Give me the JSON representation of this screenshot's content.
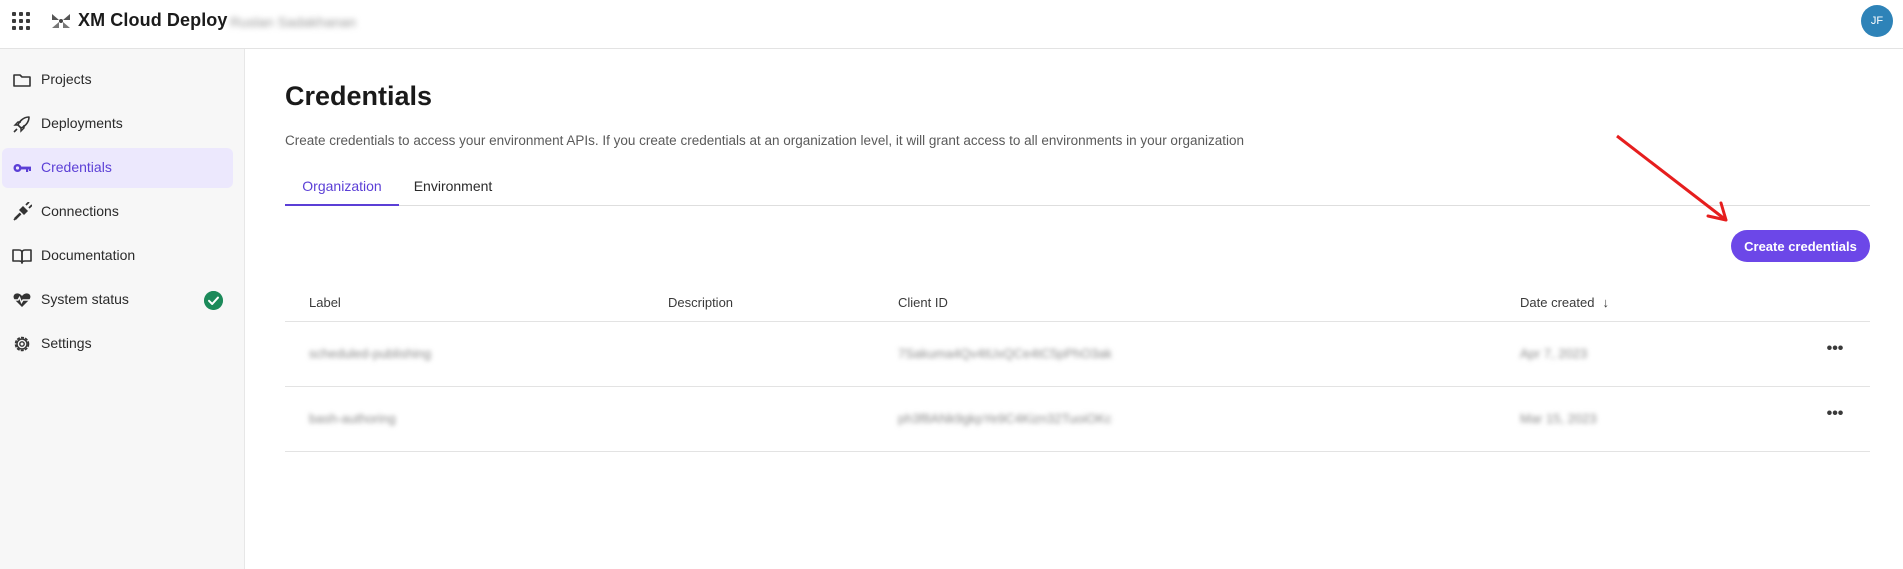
{
  "header": {
    "app_title": "XM Cloud Deploy",
    "tenant_name": "Ruslan Sadakhanan",
    "avatar_initials": "JF"
  },
  "sidebar": {
    "items": [
      {
        "label": "Projects",
        "icon": "folder-icon",
        "active": false
      },
      {
        "label": "Deployments",
        "icon": "rocket-icon",
        "active": false
      },
      {
        "label": "Credentials",
        "icon": "key-icon",
        "active": true
      },
      {
        "label": "Connections",
        "icon": "plug-icon",
        "active": false
      },
      {
        "label": "Documentation",
        "icon": "book-icon",
        "active": false
      },
      {
        "label": "System status",
        "icon": "heartbeat-icon",
        "active": false,
        "badge": "check-circle-icon"
      },
      {
        "label": "Settings",
        "icon": "gear-icon",
        "active": false
      }
    ]
  },
  "main": {
    "title": "Credentials",
    "description": "Create credentials to access your environment APIs. If you create credentials at an organization level, it will grant access to all environments in your organization",
    "tabs": [
      {
        "label": "Organization",
        "active": true
      },
      {
        "label": "Environment",
        "active": false
      }
    ],
    "create_button_label": "Create credentials",
    "table": {
      "columns": [
        "Label",
        "Description",
        "Client ID",
        "Date created"
      ],
      "sort_column": "Date created",
      "rows": [
        {
          "label": "scheduled-publishing",
          "description": "",
          "client_id": "7Sakuma4Qv4tUxQCe4tC5pPhO3ak",
          "date_created": "Apr 7, 2023"
        },
        {
          "label": "bash-authoring",
          "description": "",
          "client_id": "ph3f8ANk9gkpYe9C4Kizn32TuoiOKc",
          "date_created": "Mar 15, 2023"
        }
      ]
    }
  },
  "colors": {
    "accent": "#6c47e8",
    "active_text": "#5b3fd6",
    "active_bg": "#ece8fd",
    "status_ok": "#1c8a5a",
    "annotation_arrow": "#e61e1e"
  }
}
